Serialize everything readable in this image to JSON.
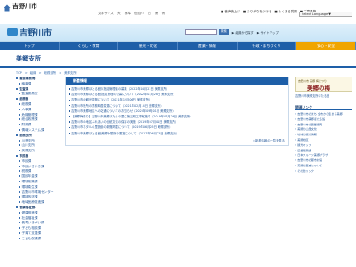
{
  "topbar": {
    "site_name": "吉野川市",
    "links": [
      "文字サイズ",
      "大",
      "標準",
      "色合い",
      "白",
      "黒",
      "青"
    ],
    "util_buttons": [
      "■ 音声読上げ",
      "■ ふりがなをつける",
      "■ よくある質問",
      "■ ご意見箱"
    ],
    "language_select": "Select Language ▼"
  },
  "header": {
    "logo_text": "吉野川市",
    "search_button": "検索",
    "links": [
      "▶ 組織から探す",
      "▶ サイトマップ"
    ]
  },
  "nav": {
    "items": [
      "トップ",
      "くらし・教育",
      "観光・文化",
      "産業・情報",
      "行政・まちづくり",
      "安心・安全"
    ],
    "active_index": 5
  },
  "page": {
    "title": "美郷支所"
  },
  "breadcrumb": [
    "TOP",
    ">",
    "組織",
    ">",
    "総務支所",
    ">",
    "美郷支所"
  ],
  "sidebar": {
    "items": [
      {
        "label": "議会事務局",
        "level": "head"
      },
      {
        "label": "議事課",
        "level": "lvl1"
      },
      {
        "label": "監査課",
        "level": "head"
      },
      {
        "label": "監査委員室",
        "level": "lvl1"
      },
      {
        "label": "総務部",
        "level": "head"
      },
      {
        "label": "総務課",
        "level": "lvl1"
      },
      {
        "label": "人事課",
        "level": "lvl1"
      },
      {
        "label": "危機管理課",
        "level": "lvl1"
      },
      {
        "label": "総合政策課",
        "level": "lvl1"
      },
      {
        "label": "財政課",
        "level": "lvl1"
      },
      {
        "label": "情報システム課",
        "level": "lvl1"
      },
      {
        "label": "総務支所",
        "level": "head"
      },
      {
        "label": "川島支所",
        "level": "lvl1"
      },
      {
        "label": "山川支所",
        "level": "lvl1"
      },
      {
        "label": "美郷支所",
        "level": "lvl1"
      },
      {
        "label": "市民部",
        "level": "head"
      },
      {
        "label": "市民課",
        "level": "lvl1"
      },
      {
        "label": "市民いきいき課",
        "level": "lvl1"
      },
      {
        "label": "税務課",
        "level": "lvl1"
      },
      {
        "label": "国民年金課",
        "level": "lvl1"
      },
      {
        "label": "環境政策課",
        "level": "lvl1"
      },
      {
        "label": "環境衛生課",
        "level": "lvl1"
      },
      {
        "label": "吉野川市環境センター",
        "level": "lvl1"
      },
      {
        "label": "環境放送課",
        "level": "lvl1"
      },
      {
        "label": "地域医療推進課",
        "level": "lvl1"
      },
      {
        "label": "健康福祉部",
        "level": "head"
      },
      {
        "label": "健康推進課",
        "level": "lvl1"
      },
      {
        "label": "社会福祉課",
        "level": "lvl1"
      },
      {
        "label": "長寿いきがい課",
        "level": "lvl1"
      },
      {
        "label": "子ども相談課",
        "level": "lvl1"
      },
      {
        "label": "子育て支援課",
        "level": "lvl1"
      },
      {
        "label": "こども保健課",
        "level": "lvl1"
      }
    ]
  },
  "news": {
    "heading": "新着情報",
    "items": [
      "吉野川市美郷ほたる館の指定管理者の募集（2022年04月21日 美郷支所）",
      "吉野川市美郷ほたる館 指定管理の公募について（2022年03月28日 美郷支所）",
      "吉野川市の観光振興について（2021年12月06日 美郷支所）",
      "吉野川市役所の業務時間変更について（2021年02月14日 美郷支所）",
      "吉野川市美郷地区への交通についてのお知らせ（2020年09月01日 美郷支所）",
      "【美郷梅祭り】吉野川市美郷ほたるの里に第三期工事実施中（2019年07月26日 美郷支所）",
      "吉野川市の地区ふれあいの伝統文化の保存の実施（2019年07月01日 美郷支所）",
      "吉野川市ホタルの里施設の新聞掲載について（2019年06月05日 美郷支所）",
      "吉野川市美郷ほたる館 美郷休憩所の運営について（2017年06月23日 美郷支所）"
    ],
    "more_link": "▷新着情報の一覧を見る"
  },
  "rightcol": {
    "banner_sub": "吉野川市 美郷 梅まつり",
    "banner_main": "美郷の梅",
    "banner_caption": "吉野川市美郷支所ほたる館",
    "related_heading": "関連リンク",
    "related_items": [
      "吉野川市のまち 全市から集まる美郷",
      "吉野川市美郷ほたる館",
      "吉野川市の農業振興",
      "美郷の山里文化",
      "地域の観光情報",
      "美郷地区",
      "観光マップ",
      "農業振興課",
      "日本フルーツ美郷プラザ",
      "吉野川市の都市計画",
      "美郷の歴史について",
      "その他リンク"
    ]
  }
}
